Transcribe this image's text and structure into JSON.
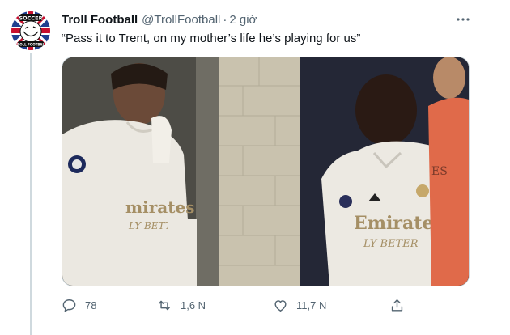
{
  "tweet": {
    "author_name": "Troll Football",
    "handle": "@TrollFootball",
    "separator": "·",
    "time": "2 giờ",
    "text": "“Pass it to Trent, on my mother’s life he’s playing for us”",
    "avatar": {
      "icon": "troll-football-logo-icon",
      "logo_top_text": "SOCCER",
      "logo_bottom_text": "TROLL FOOTBALL"
    },
    "media": {
      "jersey_sponsor_left": "mirates",
      "jersey_sponsor_left_sub": "LY BETTER",
      "jersey_sponsor_right": "Emirates",
      "jersey_sponsor_right_sub": "LY BETER",
      "keeper_text": "ES"
    }
  },
  "actions": {
    "reply": {
      "icon": "reply-icon",
      "count": "78"
    },
    "retweet": {
      "icon": "retweet-icon",
      "count": "1,6 N"
    },
    "like": {
      "icon": "like-icon",
      "count": "11,7 N"
    },
    "share": {
      "icon": "share-icon"
    }
  },
  "colors": {
    "text_primary": "#0f1419",
    "text_secondary": "#536471",
    "border": "#cfd9de"
  }
}
